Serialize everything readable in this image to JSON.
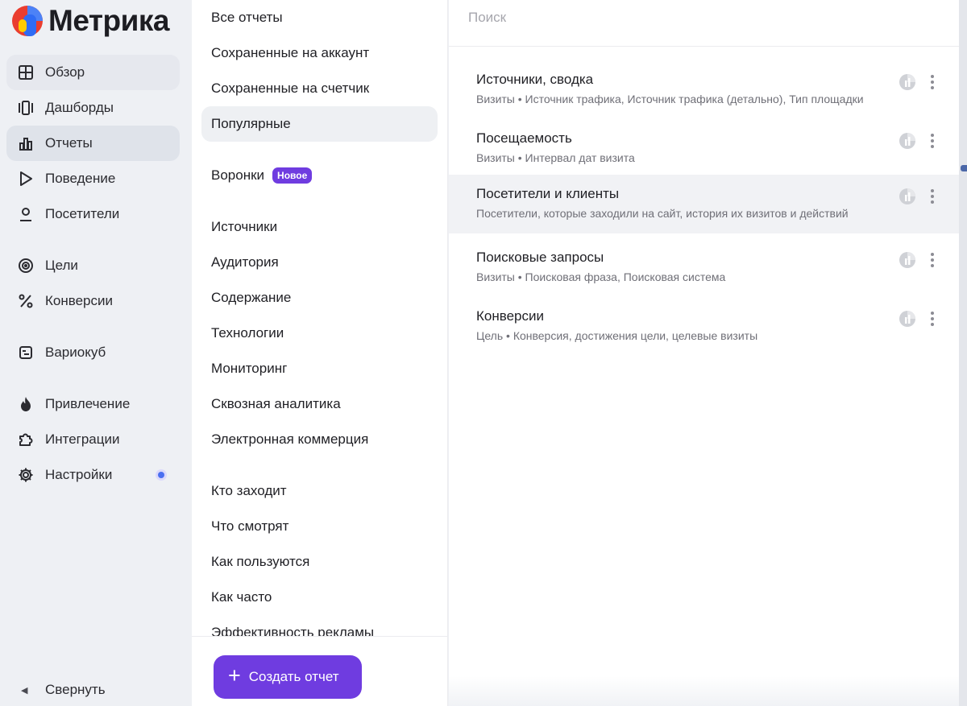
{
  "brand": {
    "name": "Метрика"
  },
  "colors": {
    "accent": "#6f3ce0",
    "notify_dot": "#4b6ff0",
    "nav_bg": "#eef0f4"
  },
  "sidebar": {
    "items": [
      {
        "label": "Обзор",
        "icon": "grid-icon"
      },
      {
        "label": "Дашборды",
        "icon": "dashboards-icon"
      },
      {
        "label": "Отчеты",
        "icon": "bar-chart-icon"
      },
      {
        "label": "Поведение",
        "icon": "play-icon"
      },
      {
        "label": "Посетители",
        "icon": "person-icon"
      },
      {
        "label": "Цели",
        "icon": "target-icon"
      },
      {
        "label": "Конверсии",
        "icon": "percent-icon"
      },
      {
        "label": "Вариокуб",
        "icon": "variocube-icon"
      },
      {
        "label": "Привлечение",
        "icon": "flame-icon"
      },
      {
        "label": "Интеграции",
        "icon": "puzzle-icon"
      },
      {
        "label": "Настройки",
        "icon": "gear-icon"
      }
    ],
    "collapse_label": "Свернуть"
  },
  "categories": {
    "items": [
      "Все отчеты",
      "Сохраненные на аккаунт",
      "Сохраненные на счетчик",
      "Популярные",
      "Воронки",
      "Источники",
      "Аудитория",
      "Содержание",
      "Технологии",
      "Мониторинг",
      "Сквозная аналитика",
      "Электронная коммерция",
      "Кто заходит",
      "Что смотрят",
      "Как пользуются",
      "Как часто",
      "Эффективность рекламы"
    ],
    "selected": "Популярные",
    "new_badge": "Новое",
    "create_button": "Создать отчет"
  },
  "search": {
    "placeholder": "Поиск"
  },
  "reports": [
    {
      "title": "Источники, сводка",
      "subtitle": "Визиты • Источник трафика, Источник трафика (детально), Тип площадки"
    },
    {
      "title": "Посещаемость",
      "subtitle": "Визиты • Интервал дат визита"
    },
    {
      "title": "Посетители и клиенты",
      "subtitle": "Посетители, которые заходили на сайт, история их визитов и действий"
    },
    {
      "title": "Поисковые запросы",
      "subtitle": "Визиты • Поисковая фраза, Поисковая система"
    },
    {
      "title": "Конверсии",
      "subtitle": "Цель • Конверсия, достижения цели, целевые визиты"
    }
  ]
}
